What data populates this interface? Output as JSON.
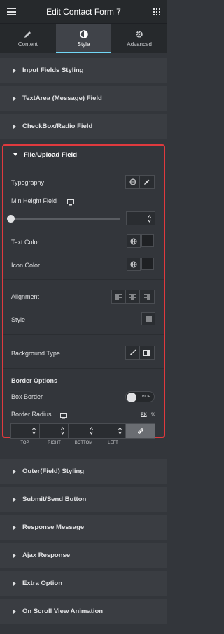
{
  "header": {
    "title": "Edit Contact Form 7"
  },
  "tabs": [
    {
      "label": "Content",
      "icon": "pencil-icon"
    },
    {
      "label": "Style",
      "icon": "half-circle-icon"
    },
    {
      "label": "Advanced",
      "icon": "gear-icon"
    }
  ],
  "sections_top": [
    {
      "label": "Input Fields Styling"
    },
    {
      "label": "TextArea (Message) Field"
    },
    {
      "label": "CheckBox/Radio Field"
    }
  ],
  "expanded": {
    "title": "File/Upload Field",
    "typography_label": "Typography",
    "min_height_label": "Min Height Field",
    "min_height_value": "",
    "text_color_label": "Text Color",
    "icon_color_label": "Icon Color",
    "alignment_label": "Alignment",
    "style_label": "Style",
    "background_type_label": "Background Type",
    "border_options_label": "Border Options",
    "box_border_label": "Box Border",
    "box_border_toggle": "HIDE",
    "border_radius_label": "Border Radius",
    "unit_px": "PX",
    "unit_pct": "%",
    "dims": [
      "TOP",
      "RIGHT",
      "BOTTOM",
      "LEFT"
    ]
  },
  "sections_bottom": [
    {
      "label": "Outer(Field) Styling"
    },
    {
      "label": "Submit/Send Button"
    },
    {
      "label": "Response Message"
    },
    {
      "label": "Ajax Response"
    },
    {
      "label": "Extra Option"
    },
    {
      "label": "On Scroll View Animation"
    }
  ],
  "colors": {
    "accent": "#71d7f7",
    "highlight_border": "#e03a3e",
    "panel_bg": "#33363b"
  }
}
